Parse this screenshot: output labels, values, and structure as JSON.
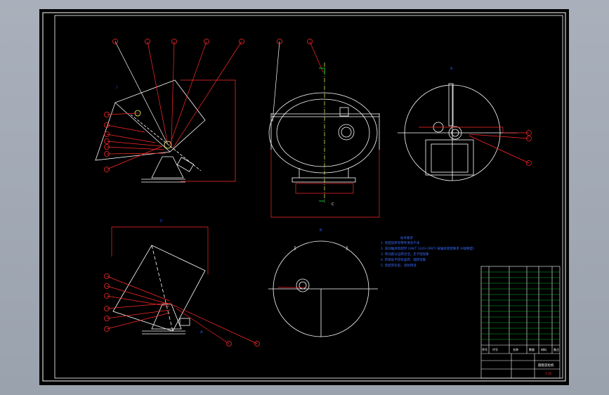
{
  "drawing": {
    "colors": {
      "background": "#000000",
      "frame": "#ffffff",
      "outline": "#ffffff",
      "leader": "#ff2a2a",
      "callout": "#ff2a2a",
      "section_mark": "#2f5bff",
      "note_text": "#3a6bff",
      "title_block_text": "#00ff33",
      "axis": "#ffff66"
    },
    "view_labels": {
      "v_side_top": "I",
      "v_side_bottom": "II",
      "v_front": "",
      "v_right": "A",
      "v_bottom": "B",
      "arrow_a": "A",
      "section_c": "C"
    },
    "notes": {
      "title": "技术要求",
      "lines": [
        "1. 装配前所有零件清洗干净",
        "2. 滚动轴承装配时 (GB/T 1243-1997) 按轴承装配要求 (II级精度)",
        "3. 转动部分运转灵活，无卡阻现象",
        "4. 焊接处不得有虚焊、漏焊现象",
        "5. 装配完毕后，涂防锈漆"
      ]
    },
    "title_block": {
      "drawing_name": "圆盘造粒机",
      "headers": [
        "序号",
        "代号",
        "名称",
        "数量",
        "材料",
        "备注"
      ],
      "sheet": "1:10"
    }
  }
}
